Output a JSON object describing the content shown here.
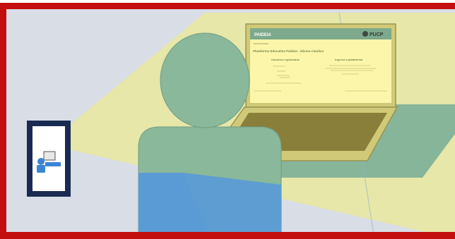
{
  "illustration": {
    "laptop_screen": {
      "header_left": "PAIDEIA",
      "logo": "PUCP",
      "page_title": "Plataforma Educativa Paideia - Idioma Catolica",
      "column_left_title": "Usuarios registrados",
      "column_right_title": "Ingreso a plataforma"
    }
  },
  "colors": {
    "frame_red": "#c40f0f",
    "background_gray": "#d8dde6",
    "light_beam": "#e6e7a8",
    "person_green": "#8ab89a",
    "person_blue": "#5b9bd5",
    "screen_yellow": "#fbf6a9",
    "laptop_frame": "#cfc978",
    "laptop_keyboard": "#8a7f3a",
    "desk_green": "#87b59a",
    "projector_frame": "#1a2b52"
  },
  "icons": {
    "projector": "projector-icon",
    "person": "person-icon",
    "laptop": "laptop-icon"
  }
}
